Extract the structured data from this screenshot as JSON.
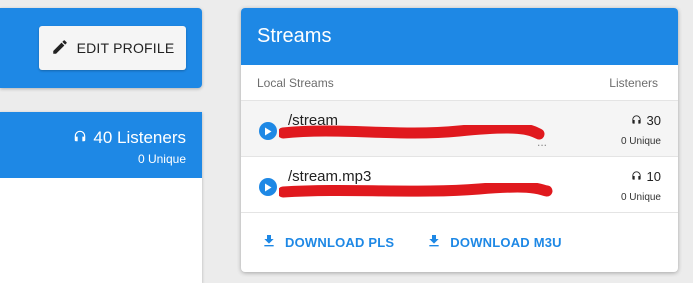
{
  "profile": {
    "edit_label": "EDIT PROFILE"
  },
  "summary": {
    "listeners": "40 Listeners",
    "unique": "0 Unique"
  },
  "streams": {
    "title": "Streams",
    "col_local": "Local Streams",
    "col_listeners": "Listeners",
    "items": [
      {
        "name": "/stream",
        "listeners": "30",
        "unique": "0 Unique",
        "desc": "..."
      },
      {
        "name": "/stream.mp3",
        "listeners": "10",
        "unique": "0 Unique"
      }
    ],
    "download_pls": "DOWNLOAD PLS",
    "download_m3u": "DOWNLOAD M3U"
  },
  "colors": {
    "accent": "#1e88e5",
    "redaction": "#e0191e"
  }
}
